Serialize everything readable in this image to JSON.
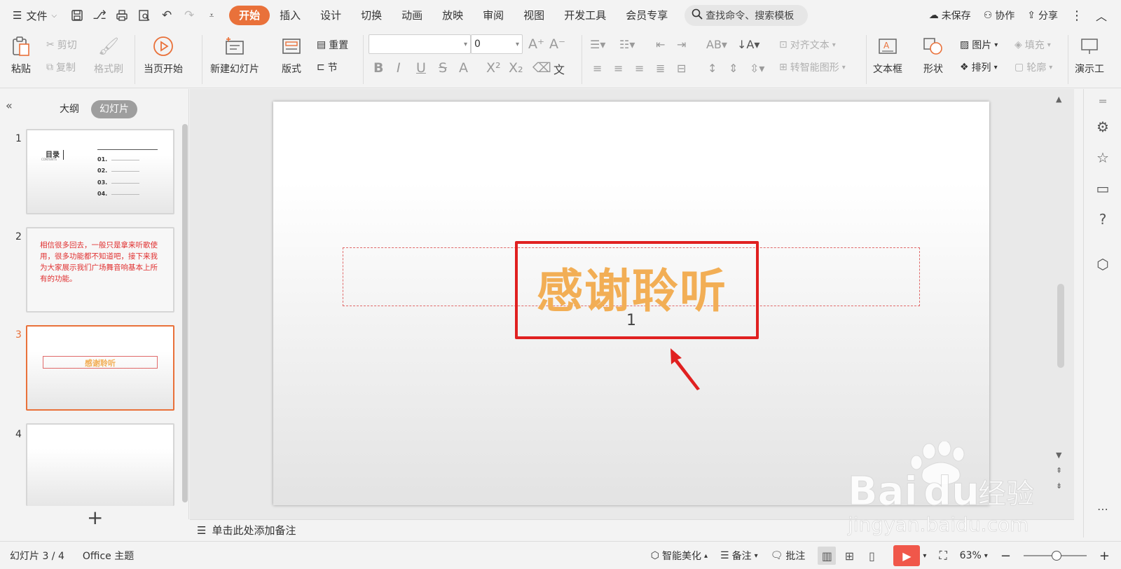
{
  "topbar": {
    "file_label": "文件",
    "tabs": [
      "开始",
      "插入",
      "设计",
      "切换",
      "动画",
      "放映",
      "审阅",
      "视图",
      "开发工具",
      "会员专享"
    ],
    "active_tab": "开始",
    "search_placeholder": "查找命令、搜索模板",
    "unsaved": "未保存",
    "collaborate": "协作",
    "share": "分享"
  },
  "ribbon": {
    "paste": "粘贴",
    "cut": "剪切",
    "copy": "复制",
    "format_painter": "格式刷",
    "start_from_current": "当页开始",
    "new_slide": "新建幻灯片",
    "layout": "版式",
    "reset": "重置",
    "section": "节",
    "font_size": "0",
    "align_text": "对齐文本",
    "smart_art": "转智能图形",
    "textbox": "文本框",
    "shape": "形状",
    "picture": "图片",
    "arrange": "排列",
    "fill": "填充",
    "outline": "轮廓",
    "presentation_tools": "演示工"
  },
  "left_panel": {
    "tab_outline": "大纲",
    "tab_slides": "幻灯片",
    "slides": [
      {
        "num": "1",
        "title": "目录",
        "subtitle": "CONTENTS",
        "items": [
          "01.",
          "02.",
          "03.",
          "04."
        ]
      },
      {
        "num": "2",
        "text": "相信很多回去，一般只是拿来听歌使用，很多功能都不知道吧，接下来我为大家展示我们广场舞音响基本上所有的功能。"
      },
      {
        "num": "3",
        "title": "感谢聆听"
      },
      {
        "num": "4"
      }
    ],
    "active_slide": 3
  },
  "slide": {
    "title": "感谢聆听",
    "subtitle": "1",
    "title_color": "#f2ae55",
    "annotation_color": "#e02020"
  },
  "notes": {
    "placeholder": "单击此处添加备注"
  },
  "statusbar": {
    "slide_counter": "幻灯片 3 / 4",
    "theme": "Office 主题",
    "beautify": "智能美化",
    "notes": "备注",
    "comments": "批注",
    "zoom": "63%"
  },
  "watermark": {
    "brand": "Bai du 经验",
    "url": "jingyan.baidu.com"
  }
}
